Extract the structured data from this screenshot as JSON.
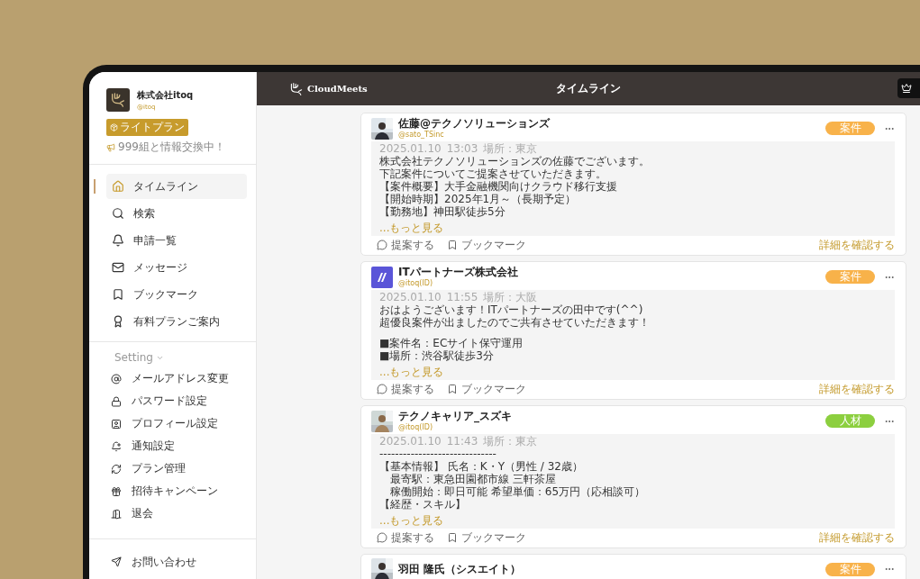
{
  "profile": {
    "name": "株式会社itoq",
    "handle": "@itoq",
    "plan": "ライトプラン",
    "exchange": "999組と情報交換中！"
  },
  "nav": [
    {
      "label": "タイムライン",
      "selected": true
    },
    {
      "label": "検索",
      "selected": false
    },
    {
      "label": "申請一覧",
      "selected": false
    },
    {
      "label": "メッセージ",
      "selected": false
    },
    {
      "label": "ブックマーク",
      "selected": false
    },
    {
      "label": "有料プランご案内",
      "selected": false
    }
  ],
  "settings": {
    "label": "Setting",
    "expanded": true,
    "items": [
      {
        "label": "メールアドレス変更"
      },
      {
        "label": "パスワード設定"
      },
      {
        "label": "プロフィール設定"
      },
      {
        "label": "通知設定"
      },
      {
        "label": "プラン管理"
      },
      {
        "label": "招待キャンペーン"
      },
      {
        "label": "退会"
      }
    ]
  },
  "contact": {
    "label": "お問い合わせ"
  },
  "header": {
    "logo": "CloudMeets",
    "title": "タイムライン"
  },
  "posts": [
    {
      "name": "佐藤@テクノソリューションズ",
      "handle": "@sato_TSinc",
      "tag": "案件",
      "color": "#f8b24a",
      "date": "2025.01.10",
      "time": "13:03",
      "place": "場所：東京",
      "paragraphs": [
        [
          "株式会社テクノソリューションズの佐藤でございます。",
          "下記案件についてご提案させていただきます。",
          "【案件概要】大手金融機関向けクラウド移行支援",
          "【開始時期】2025年1月～（長期予定）",
          "【勤務地】神田駅徒歩5分"
        ]
      ],
      "more": "...もっと見る",
      "propose": "提案する",
      "bookmark": "ブックマーク",
      "detail": "詳細を確認する"
    },
    {
      "kind": "logo",
      "name": "ITパートナーズ株式会社",
      "handle": "@itoq(ID)",
      "tag": "案件",
      "color": "#f8b24a",
      "date": "2025.01.10",
      "time": "11:55",
      "place": "場所：大阪",
      "paragraphs": [
        [
          "おはようございます！ITパートナーズの田中です(^^)",
          "超優良案件が出ましたのでご共有させていただきます！"
        ],
        [
          "■案件名：ECサイト保守運用",
          "■場所：渋谷駅徒歩3分"
        ]
      ],
      "more": "...もっと見る",
      "propose": "提案する",
      "bookmark": "ブックマーク",
      "detail": "詳細を確認する"
    },
    {
      "name": "テクノキャリア_スズキ",
      "handle": "@itoq(ID)",
      "tag": "人材",
      "color": "#8ccf3f",
      "date": "2025.01.10",
      "time": "11:43",
      "place": "場所：東京",
      "paragraphs": [
        [
          "------------------------------",
          "【基本情報】 氏名：K・Y（男性 / 32歳）",
          "　最寄駅：東急田園都市線 三軒茶屋",
          "　稼働開始：即日可能 希望単価：65万円（応相談可）",
          "【経歴・スキル】"
        ]
      ],
      "more": "...もっと見る",
      "propose": "提案する",
      "bookmark": "ブックマーク",
      "detail": "詳細を確認する"
    },
    {
      "name": "羽田 隆氏（シスエイト）",
      "tag": "案件",
      "color": "#f8b24a"
    }
  ]
}
